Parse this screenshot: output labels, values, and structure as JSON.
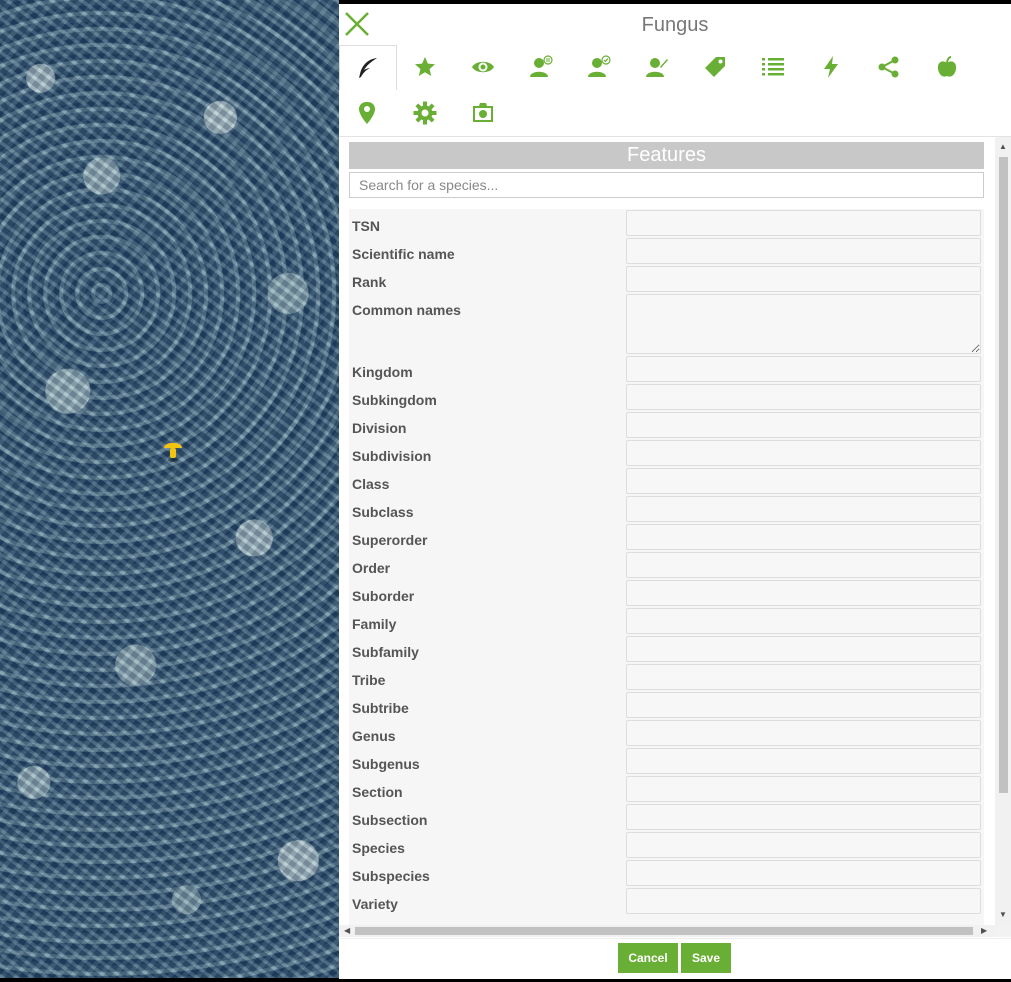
{
  "window": {
    "title": "Fungus"
  },
  "colors": {
    "accent": "#6aaf35",
    "active_tab_icon": "#222222",
    "marker": "#f2c40f"
  },
  "map": {
    "marker_icon": "mushroom-icon"
  },
  "tabs": [
    {
      "name": "tab-details",
      "icon": "feather-icon",
      "active": true
    },
    {
      "name": "tab-favorites",
      "icon": "star-icon"
    },
    {
      "name": "tab-observation",
      "icon": "eye-icon"
    },
    {
      "name": "tab-user-info",
      "icon": "user-info-icon"
    },
    {
      "name": "tab-user-check",
      "icon": "user-check-icon"
    },
    {
      "name": "tab-user-edit",
      "icon": "user-edit-icon"
    },
    {
      "name": "tab-tags",
      "icon": "tag-icon"
    },
    {
      "name": "tab-list",
      "icon": "list-icon"
    },
    {
      "name": "tab-actions",
      "icon": "lightning-icon"
    },
    {
      "name": "tab-share",
      "icon": "share-icon"
    },
    {
      "name": "tab-fruit",
      "icon": "apple-icon"
    },
    {
      "name": "tab-location",
      "icon": "location-pin-icon"
    },
    {
      "name": "tab-settings",
      "icon": "gear-icon"
    },
    {
      "name": "tab-photo",
      "icon": "camera-icon"
    }
  ],
  "form": {
    "section_title": "Features",
    "search_placeholder": "Search for a species...",
    "fields": [
      {
        "label": "TSN",
        "value": ""
      },
      {
        "label": "Scientific name",
        "value": ""
      },
      {
        "label": "Rank",
        "value": ""
      },
      {
        "label": "Common names",
        "value": "",
        "multiline": true
      },
      {
        "label": "Kingdom",
        "value": ""
      },
      {
        "label": "Subkingdom",
        "value": ""
      },
      {
        "label": "Division",
        "value": ""
      },
      {
        "label": "Subdivision",
        "value": ""
      },
      {
        "label": "Class",
        "value": ""
      },
      {
        "label": "Subclass",
        "value": ""
      },
      {
        "label": "Superorder",
        "value": ""
      },
      {
        "label": "Order",
        "value": ""
      },
      {
        "label": "Suborder",
        "value": ""
      },
      {
        "label": "Family",
        "value": ""
      },
      {
        "label": "Subfamily",
        "value": ""
      },
      {
        "label": "Tribe",
        "value": ""
      },
      {
        "label": "Subtribe",
        "value": ""
      },
      {
        "label": "Genus",
        "value": ""
      },
      {
        "label": "Subgenus",
        "value": ""
      },
      {
        "label": "Section",
        "value": ""
      },
      {
        "label": "Subsection",
        "value": ""
      },
      {
        "label": "Species",
        "value": ""
      },
      {
        "label": "Subspecies",
        "value": ""
      },
      {
        "label": "Variety",
        "value": ""
      }
    ]
  },
  "footer": {
    "cancel_label": "Cancel",
    "save_label": "Save"
  }
}
